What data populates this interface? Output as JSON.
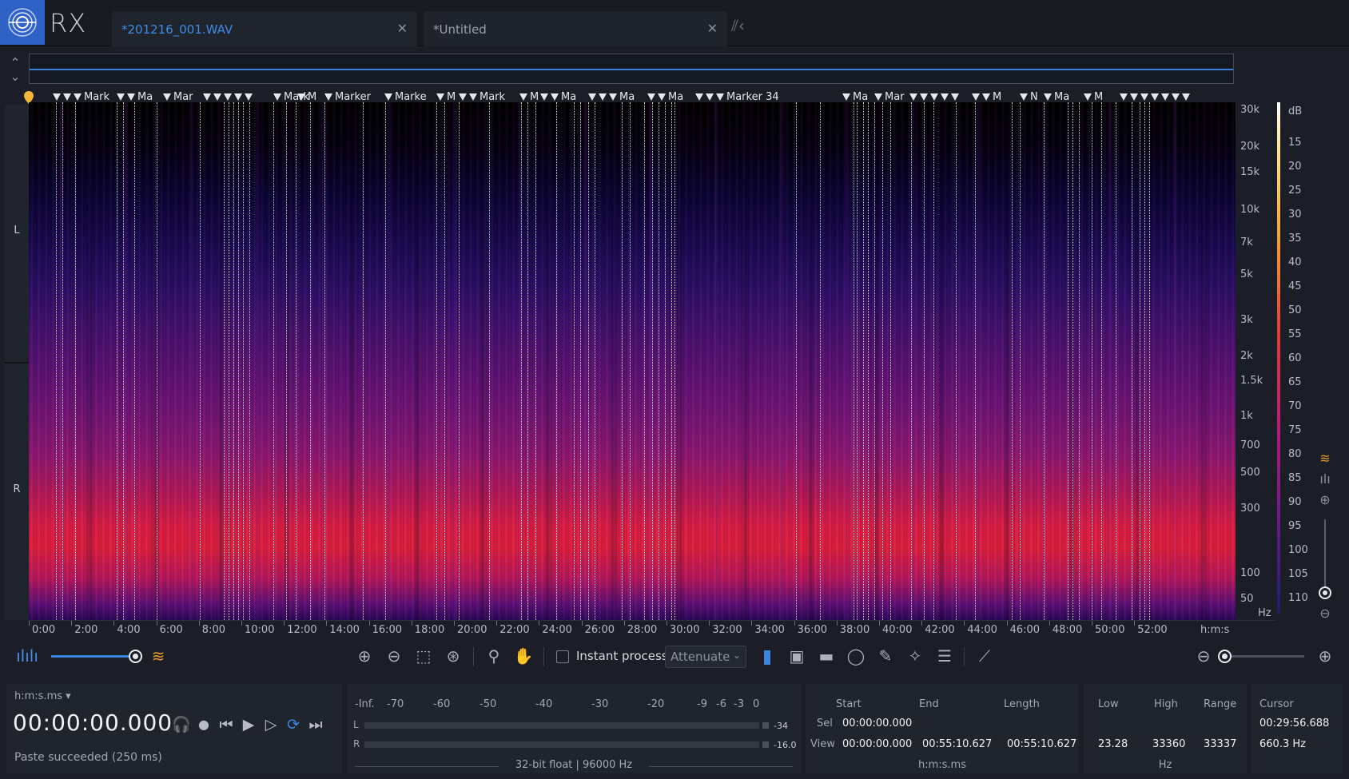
{
  "app": {
    "name": "RX"
  },
  "tabs": [
    {
      "label": "*201216_001.WAV",
      "active": true
    },
    {
      "label": "*Untitled",
      "active": false
    }
  ],
  "channels": [
    "L",
    "R"
  ],
  "markers": [
    "Mark",
    "Ma",
    "Mar",
    "Mark",
    "M",
    "Marker",
    "Marke",
    "M",
    "Mark",
    "M",
    "Ma",
    "Ma",
    "Ma",
    "Marker 34",
    "Ma",
    "Mar",
    "M",
    "N",
    "Ma",
    "M"
  ],
  "freq_axis": [
    "30k",
    "20k",
    "15k",
    "10k",
    "7k",
    "5k",
    "3k",
    "2k",
    "1.5k",
    "1k",
    "700",
    "500",
    "300",
    "100",
    "50",
    "Hz"
  ],
  "db_axis": [
    "dB",
    "15",
    "20",
    "25",
    "30",
    "35",
    "40",
    "45",
    "50",
    "55",
    "60",
    "65",
    "70",
    "75",
    "80",
    "85",
    "90",
    "95",
    "100",
    "105",
    "110"
  ],
  "time_axis": [
    "0:00",
    "2:00",
    "4:00",
    "6:00",
    "8:00",
    "10:00",
    "12:00",
    "14:00",
    "16:00",
    "18:00",
    "20:00",
    "22:00",
    "24:00",
    "26:00",
    "28:00",
    "30:00",
    "32:00",
    "34:00",
    "36:00",
    "38:00",
    "40:00",
    "42:00",
    "44:00",
    "46:00",
    "48:00",
    "50:00",
    "52:00",
    "h:m:s"
  ],
  "toolbar": {
    "instant_process_label": "Instant process",
    "instant_process_checked": false,
    "mode_select_value": "Attenuate"
  },
  "transport": {
    "time_format": "h:m:s.ms",
    "timecode": "00:00:00.000",
    "status": "Paste succeeded (250 ms)"
  },
  "meter": {
    "scale": [
      "-Inf.",
      "-70",
      "-60",
      "-50",
      "-40",
      "-30",
      "-20",
      "-9",
      "-6",
      "-3",
      "0"
    ],
    "left_label": "L",
    "right_label": "R",
    "left_peak": "-34",
    "right_peak": "-16.0",
    "format": "32-bit float | 96000 Hz"
  },
  "selection": {
    "headers": {
      "start": "Start",
      "end": "End",
      "length": "Length"
    },
    "sel_label": "Sel",
    "view_label": "View",
    "sel_start": "00:00:00.000",
    "view_start": "00:00:00.000",
    "view_end": "00:55:10.627",
    "view_length": "00:55:10.627",
    "unit": "h:m:s.ms"
  },
  "frequency": {
    "headers": {
      "low": "Low",
      "high": "High",
      "range": "Range"
    },
    "low": "23.28",
    "high": "33360",
    "range": "33337",
    "unit": "Hz"
  },
  "cursor": {
    "header": "Cursor",
    "time": "00:29:56.688",
    "freq": "660.3 Hz"
  }
}
